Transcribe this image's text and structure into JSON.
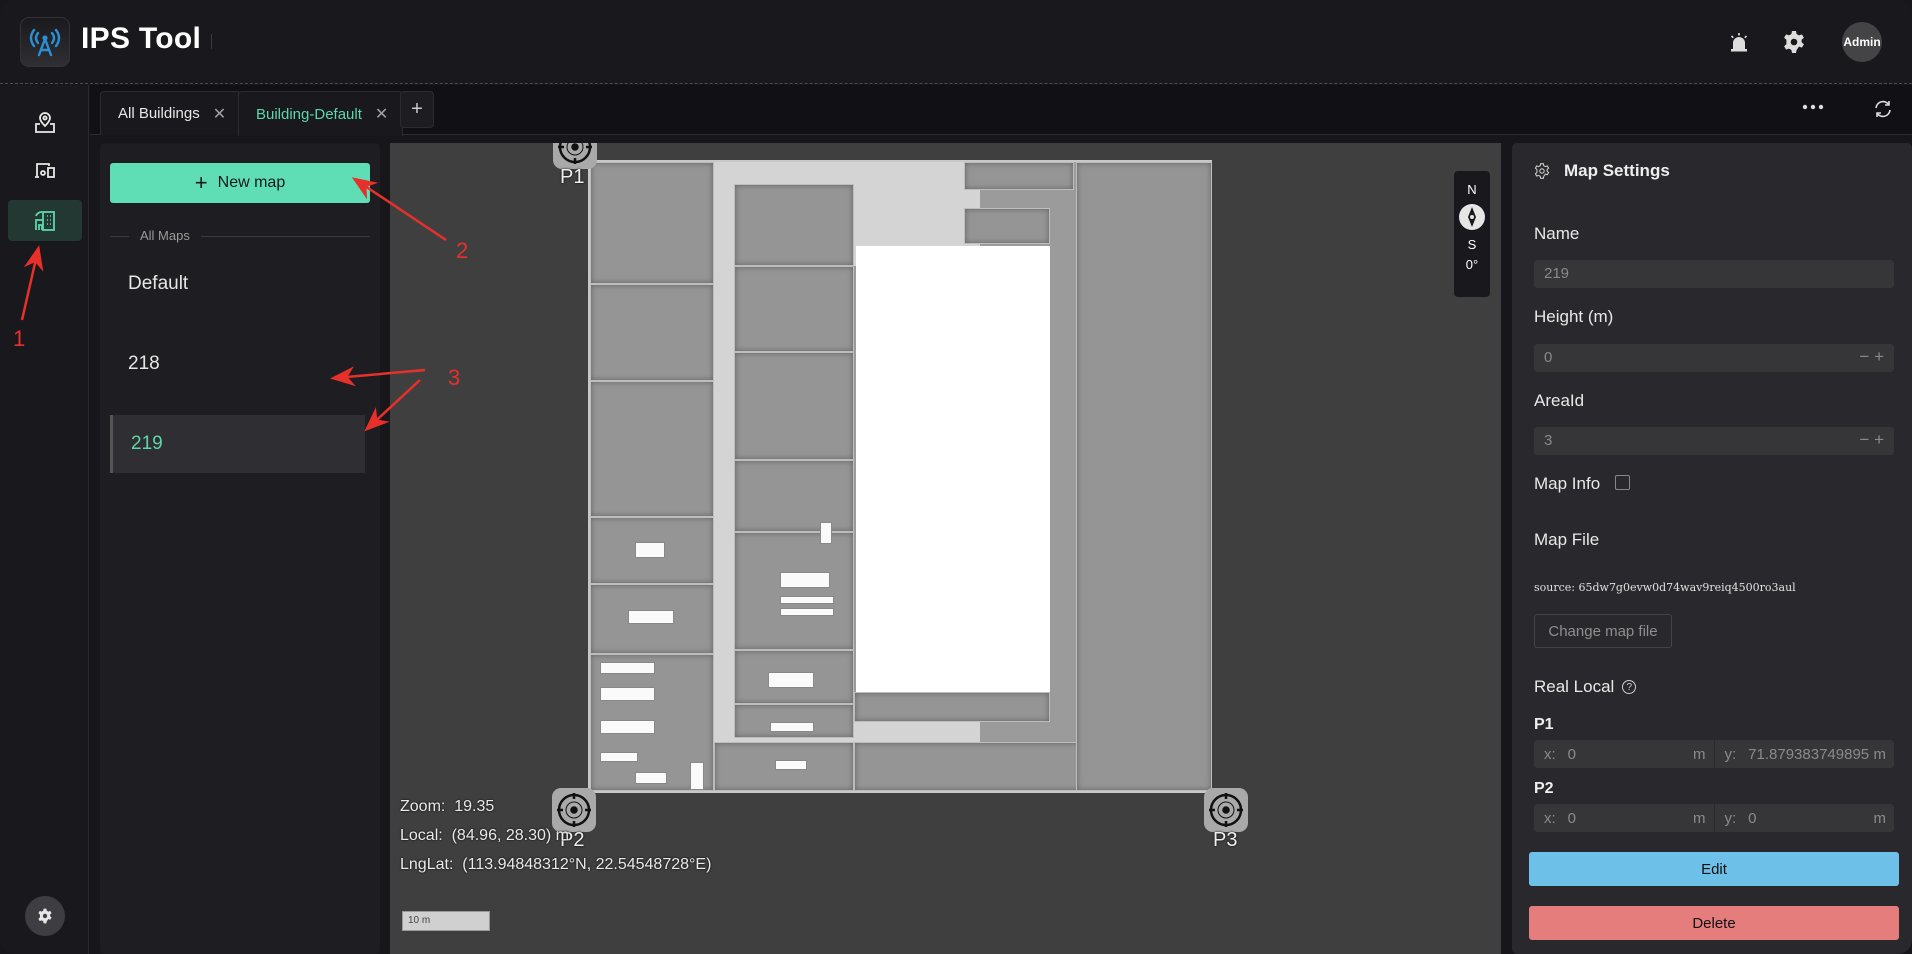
{
  "header": {
    "app_title": "IPS Tool",
    "avatar_label": "Admin",
    "icons": [
      "siren-alarm-icon",
      "gear-icon"
    ]
  },
  "sidebar": {
    "items": [
      {
        "icon": "map-pin-icon",
        "active": false
      },
      {
        "icon": "devices-icon",
        "active": false
      },
      {
        "icon": "building-icon",
        "active": true
      }
    ],
    "bottom_icon": "gear-icon"
  },
  "tabs": {
    "items": [
      {
        "label": "All Buildings",
        "active": false
      },
      {
        "label": "Building-Default",
        "active": true
      }
    ],
    "add_label": "+",
    "more_icon": "more-horizontal-icon",
    "refresh_icon": "refresh-icon"
  },
  "left_panel": {
    "new_map_label": "New map",
    "section_label": "All Maps",
    "maps": [
      {
        "name": "Default",
        "active": false
      },
      {
        "name": "218",
        "active": false
      },
      {
        "name": "219",
        "active": true
      }
    ]
  },
  "map_view": {
    "markers": [
      {
        "label": "P1"
      },
      {
        "label": "P2"
      },
      {
        "label": "P3"
      }
    ],
    "compass": {
      "north": "N",
      "south": "S",
      "rotation": "0°"
    },
    "zoom_label": "Zoom:",
    "zoom_value": "19.35",
    "local_label": "Local:",
    "local_value": "(84.96, 28.30) m",
    "lnglat_label": "LngLat:",
    "lnglat_value": "(113.94848312°N, 22.54548728°E)",
    "scale_label": "10 m"
  },
  "settings": {
    "title": "Map Settings",
    "name_label": "Name",
    "name_value": "219",
    "height_label": "Height (m)",
    "height_value": "0",
    "area_label": "AreaId",
    "area_value": "3",
    "map_info_label": "Map Info",
    "map_info_checked": false,
    "map_file_label": "Map File",
    "source_text": "source: 65dw7g0evw0d74wav9reiq4500ro3aul",
    "change_file_label": "Change map file",
    "real_local_label": "Real Local",
    "p1": {
      "label": "P1",
      "x": "0",
      "y": "71.879383749895",
      "unit": "m"
    },
    "p2": {
      "label": "P2",
      "x": "0",
      "y": "0",
      "unit": "m"
    },
    "edit_label": "Edit",
    "delete_label": "Delete",
    "stepper_minus": "−",
    "stepper_plus": "+",
    "x_key": "x:",
    "y_key": "y:"
  },
  "annotations": [
    "1",
    "2",
    "3"
  ],
  "colors": {
    "accent": "#5fdeb6",
    "edit": "#6dc0e7",
    "delete": "#e67d7d",
    "annotation": "#e8302b"
  }
}
